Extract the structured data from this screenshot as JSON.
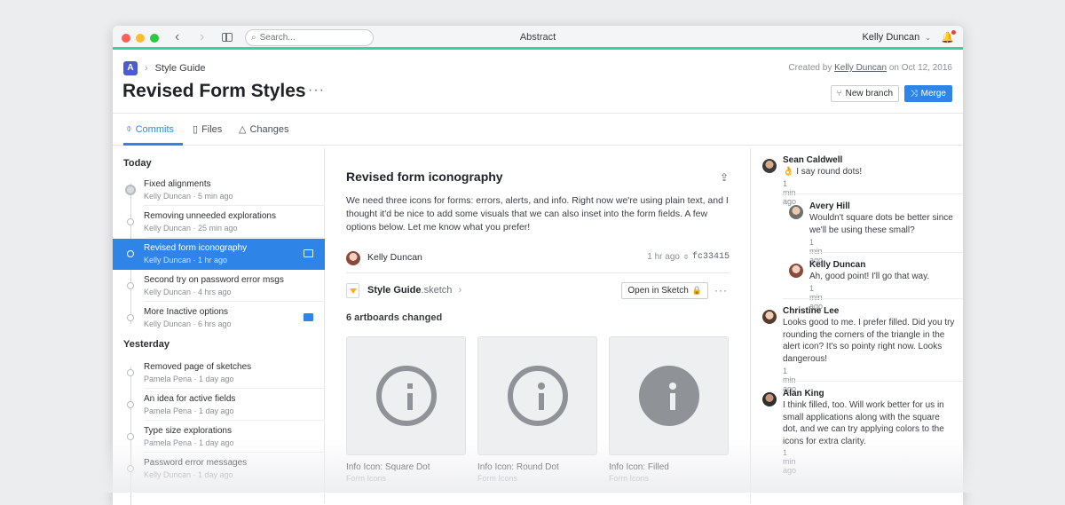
{
  "window": {
    "app_title": "Abstract",
    "search_placeholder": "Search...",
    "user_name": "Kelly Duncan",
    "colors": {
      "accent": "#2f84e8",
      "brand_bar": "#3fcf9e",
      "logo": "#4a5bd4"
    }
  },
  "header": {
    "breadcrumb": "Style Guide",
    "title": "Revised Form Styles",
    "created_prefix": "Created by",
    "created_by": "Kelly Duncan",
    "created_suffix": "on Oct 12, 2016",
    "new_branch_label": "New branch",
    "merge_label": "Merge"
  },
  "tabs": [
    {
      "label": "Commits",
      "icon": "commit-icon"
    },
    {
      "label": "Files",
      "icon": "file-icon"
    },
    {
      "label": "Changes",
      "icon": "triangle-icon"
    }
  ],
  "sidebar": {
    "today_label": "Today",
    "yesterday_label": "Yesterday",
    "today": [
      {
        "title": "Fixed alignments",
        "meta": "Kelly Duncan · 5 min ago"
      },
      {
        "title": "Removing unneeded explorations",
        "meta": "Kelly Duncan · 25 min ago"
      },
      {
        "title": "Revised form iconography",
        "meta": "Kelly Duncan · 1 hr ago"
      },
      {
        "title": "Second try on password error msgs",
        "meta": "Kelly Duncan · 4 hrs ago"
      },
      {
        "title": "More Inactive options",
        "meta": "Kelly Duncan · 6 hrs ago"
      }
    ],
    "yesterday": [
      {
        "title": "Removed page of sketches",
        "meta": "Pamela Pena · 1 day ago"
      },
      {
        "title": "An idea for active fields",
        "meta": "Pamela Pena · 1 day ago"
      },
      {
        "title": "Type size explorations",
        "meta": "Pamela Pena · 1 day ago"
      },
      {
        "title": "Password error messages",
        "meta": "Kelly Duncan · 1 day ago"
      }
    ]
  },
  "main": {
    "title": "Revised form iconography",
    "description": "We need three icons for forms: errors, alerts, and info. Right now we're using plain text, and I thought it'd be nice to add some visuals that we can also inset into the form fields. A few options below. Let me know what you prefer!",
    "author": "Kelly Duncan",
    "time": "1 hr ago",
    "hash": "fc33415",
    "file_name": "Style Guide",
    "file_ext": ".sketch",
    "open_label": "Open in Sketch",
    "artboards_count": "6 artboards changed",
    "artboards": [
      {
        "name": "Info Icon: Square Dot",
        "sub": "Form Icons"
      },
      {
        "name": "Info Icon: Round Dot",
        "sub": "Form Icons"
      },
      {
        "name": "Info Icon: Filled",
        "sub": "Form Icons"
      }
    ]
  },
  "comments": [
    {
      "name": "Sean Caldwell",
      "text": "👌 I say round dots!",
      "time": "1 min ago"
    },
    {
      "name": "Avery Hill",
      "text": "Wouldn't square dots be better since we'll be using these small?",
      "time": "1 min ago"
    },
    {
      "name": "Kelly Duncan",
      "text": "Ah, good point! I'll go that way.",
      "time": "1 min ago"
    },
    {
      "name": "Christine Lee",
      "text": "Looks good to me. I prefer filled. Did you try rounding the corners of the triangle in the alert icon? It's so pointy right now. Looks dangerous!",
      "time": "1 min ago"
    },
    {
      "name": "Alan King",
      "text": "I think filled, too. Will work better for us in small applications along with the square dot, and we can try applying colors to the icons for extra clarity.",
      "time": "1 min ago"
    }
  ]
}
